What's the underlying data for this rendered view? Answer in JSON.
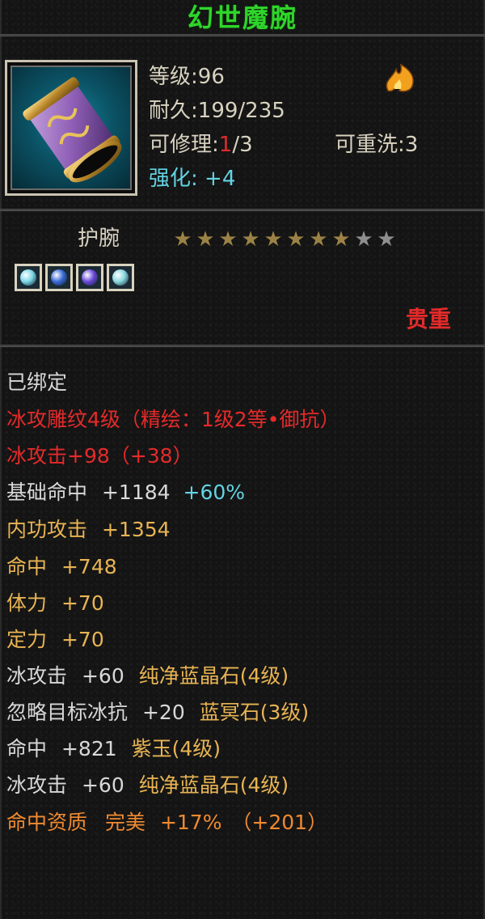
{
  "item": {
    "name": "幻世魔腕",
    "level_label": "等级",
    "level_value": "96",
    "durability_label": "耐久",
    "durability_value": "199/235",
    "repair_label": "可修理",
    "repair_current": "1",
    "repair_max": "/3",
    "rewash_label": "可重洗",
    "rewash_value": "3",
    "enhance_label": "强化",
    "enhance_value": "+4",
    "type": "护腕",
    "stars_filled": 8,
    "stars_total": 10,
    "rarity": "贵重",
    "gem_colors": [
      "#7cd8e8",
      "#3a6ad8",
      "#6a4ad8",
      "#8ad8e0"
    ]
  },
  "stats": {
    "bound": "已绑定",
    "carving": "冰攻雕纹4级（精绘：1级2等•御抗）",
    "ice_attack_base": "冰攻击+98（+38）",
    "base_hit_label": "基础命中",
    "base_hit_value": "+1184",
    "base_hit_bonus": "+60%",
    "inner_attack_label": "内功攻击",
    "inner_attack_value": "+1354",
    "hit_label": "命中",
    "hit_value": "+748",
    "stamina_label": "体力",
    "stamina_value": "+70",
    "focus_label": "定力",
    "focus_value": "+70",
    "gem_line_1_stat": "冰攻击",
    "gem_line_1_value": "+60",
    "gem_line_1_gem": "纯净蓝晶石(4级)",
    "gem_line_2_stat": "忽略目标冰抗",
    "gem_line_2_value": "+20",
    "gem_line_2_gem": "蓝冥石(3级)",
    "gem_line_3_stat": "命中",
    "gem_line_3_value": "+821",
    "gem_line_3_gem": "紫玉(4级)",
    "gem_line_4_stat": "冰攻击",
    "gem_line_4_value": "+60",
    "gem_line_4_gem": "纯净蓝晶石(4级)",
    "quality_label": "命中资质",
    "quality_grade": "完美",
    "quality_value": "+17%",
    "quality_bonus": "（+201）"
  },
  "colors": {
    "title": "#2fd52a",
    "red": "#e52a2a",
    "cyan": "#63d3e2",
    "gold": "#e8b453",
    "orange": "#f08a30"
  }
}
